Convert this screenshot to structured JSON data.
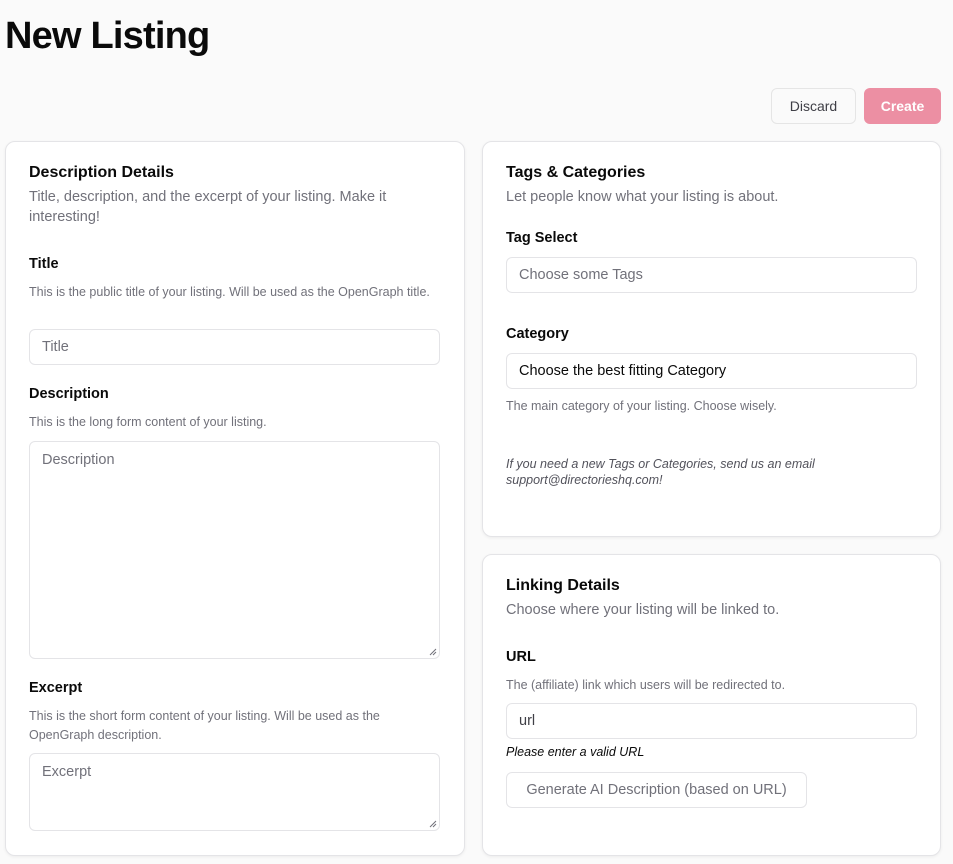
{
  "page": {
    "title": "New Listing"
  },
  "actions": {
    "discard_label": "Discard",
    "create_label": "Create"
  },
  "description_details": {
    "title": "Description Details",
    "subtitle": "Title, description, and the excerpt of your listing. Make it interesting!",
    "title_field": {
      "label": "Title",
      "help": "This is the public title of your listing. Will be used as the OpenGraph title.",
      "placeholder": "Title"
    },
    "description_field": {
      "label": "Description",
      "help": "This is the long form content of your listing.",
      "placeholder": "Description"
    },
    "excerpt_field": {
      "label": "Excerpt",
      "help": "This is the short form content of your listing. Will be used as the OpenGraph description.",
      "placeholder": "Excerpt"
    }
  },
  "tags_categories": {
    "title": "Tags & Categories",
    "subtitle": "Let people know what your listing is about.",
    "tag_select": {
      "label": "Tag Select",
      "placeholder": "Choose some Tags"
    },
    "category": {
      "label": "Category",
      "value": "Choose the best fitting Category",
      "help": "The main category of your listing. Choose wisely."
    },
    "note": "If you need a new Tags or Categories, send us an email support@directorieshq.com!"
  },
  "linking_details": {
    "title": "Linking Details",
    "subtitle": "Choose where your listing will be linked to.",
    "url_field": {
      "label": "URL",
      "help": "The (affiliate) link which users will be redirected to.",
      "value": "url",
      "error": "Please enter a valid URL"
    },
    "generate_label": "Generate AI Description (based on URL)"
  },
  "colors": {
    "accent": "#ec8fa3",
    "border": "#e4e4e7",
    "muted_text": "#71717a"
  }
}
